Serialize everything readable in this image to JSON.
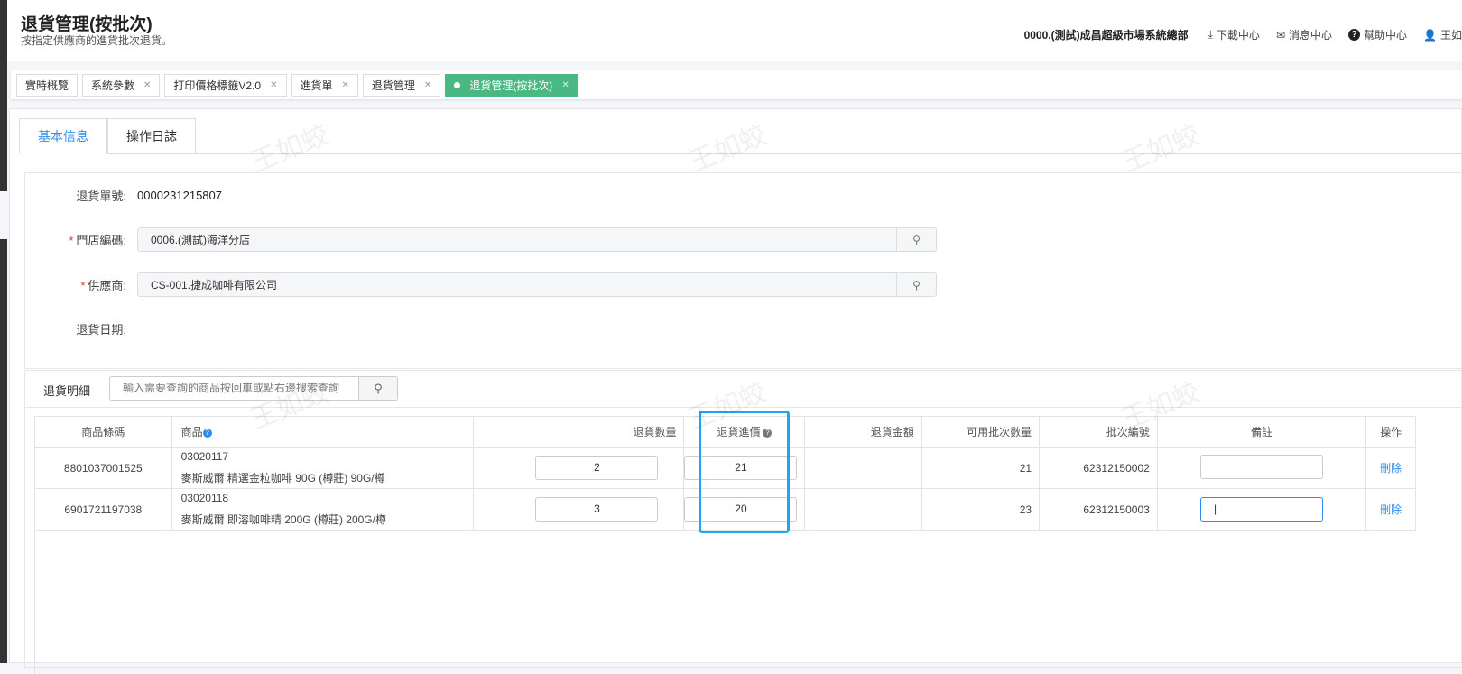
{
  "header": {
    "title": "退貨管理(按批次)",
    "subtitle": "按指定供應商的進貨批次退貨。",
    "org": "0000.(測試)成昌超級市場系統總部",
    "download": "下載中心",
    "messages": "消息中心",
    "help": "幫助中心",
    "user": "王如"
  },
  "page_tabs": [
    {
      "label": "實時概覽"
    },
    {
      "label": "系統參數"
    },
    {
      "label": "打印價格標籤V2.0"
    },
    {
      "label": "進貨單"
    },
    {
      "label": "退貨管理"
    },
    {
      "label": "退貨管理(按批次)"
    }
  ],
  "form_tabs": {
    "basic": "基本信息",
    "log": "操作日誌"
  },
  "form": {
    "return_no_label": "退貨單號:",
    "return_no": "0000231215807",
    "store_label": "門店編碼:",
    "store": "0006.(測試)海洋分店",
    "supplier_label": "供應商:",
    "supplier": "CS-001.捷成咖啡有限公司",
    "date_label": "退貨日期:",
    "required_mark": "*"
  },
  "detail": {
    "title": "退貨明細",
    "search_placeholder": "輸入需要查詢的商品按回車或點右邊搜索查詢"
  },
  "table": {
    "headers": [
      "商品條碼",
      "商品",
      "退貨數量",
      "退貨進價",
      "退貨金額",
      "可用批次數量",
      "批次編號",
      "備註",
      "操作"
    ],
    "rows": [
      {
        "barcode": "8801037001525",
        "code": "03020117",
        "name": "麥斯威爾 精選金粒咖啡 90G (樽莊) 90G/樽",
        "qty": "2",
        "price": "21",
        "amount": "",
        "available": "21",
        "batch": "62312150002",
        "remark": "",
        "action": "刪除"
      },
      {
        "barcode": "6901721197038",
        "code": "03020118",
        "name": "麥斯威爾 即溶咖啡精 200G (樽莊) 200G/樽",
        "qty": "3",
        "price": "20",
        "amount": "",
        "available": "23",
        "batch": "62312150003",
        "remark": "|",
        "action": "刪除"
      }
    ]
  },
  "watermark": "王如蛟"
}
